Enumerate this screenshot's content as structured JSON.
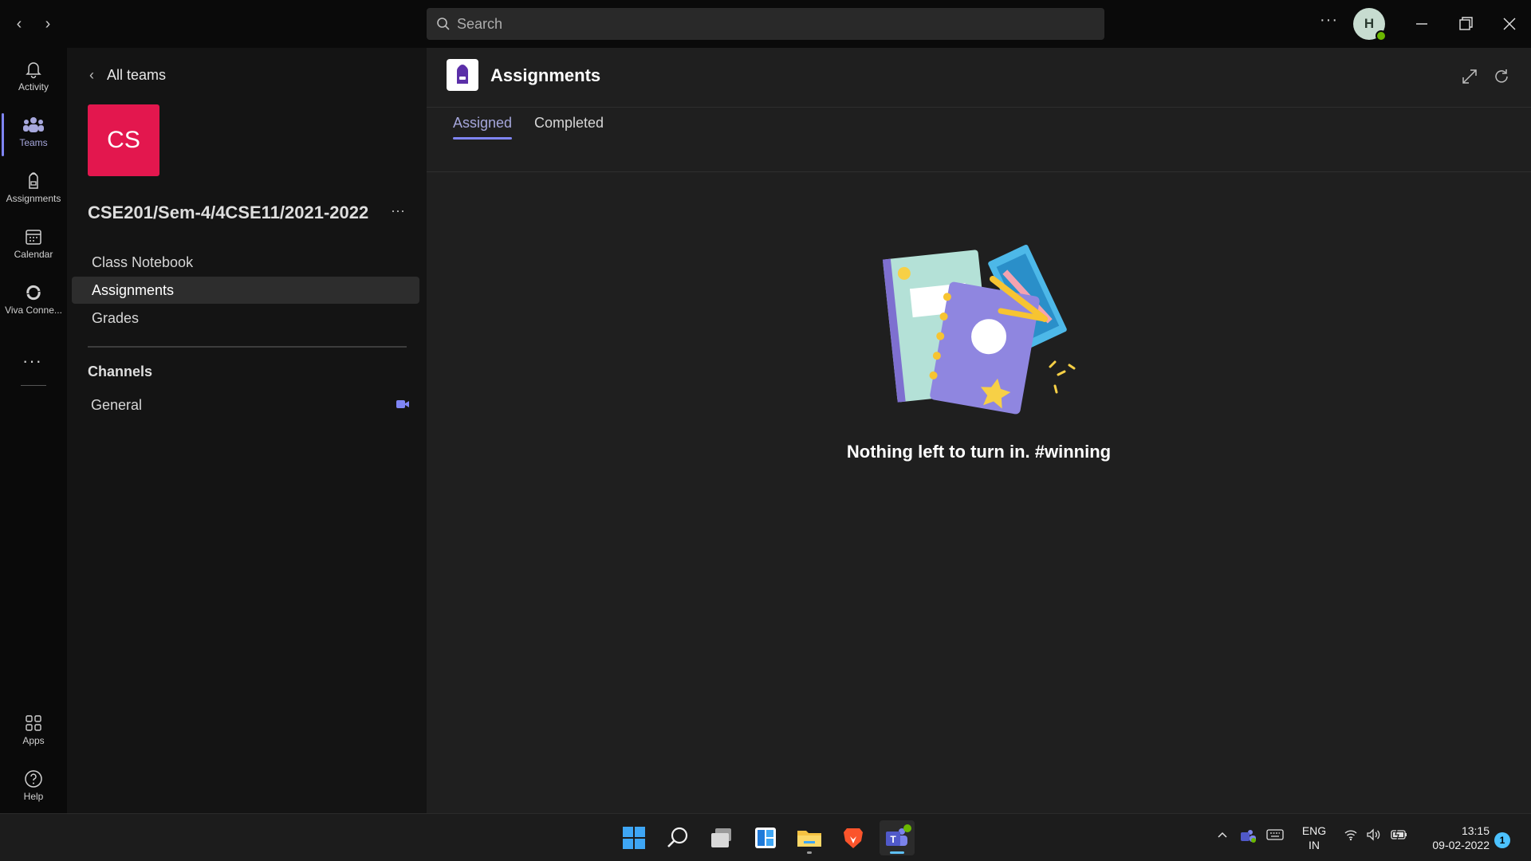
{
  "titlebar": {
    "search_placeholder": "Search",
    "more_label": "···",
    "avatar_initial": "H"
  },
  "rail": {
    "items": [
      {
        "label": "Activity",
        "icon": "bell-icon"
      },
      {
        "label": "Teams",
        "icon": "teams-icon"
      },
      {
        "label": "Assignments",
        "icon": "backpack-icon"
      },
      {
        "label": "Calendar",
        "icon": "calendar-icon"
      },
      {
        "label": "Viva Conne...",
        "icon": "viva-icon"
      }
    ],
    "more": "···",
    "bottom": [
      {
        "label": "Apps",
        "icon": "apps-icon"
      },
      {
        "label": "Help",
        "icon": "help-icon"
      }
    ]
  },
  "team_panel": {
    "back_label": "All teams",
    "tile_initials": "CS",
    "tile_color": "#e3174e",
    "team_name": "CSE201/Sem-4/4CSE11/2021-2022",
    "more_label": "···",
    "links": [
      "Class Notebook",
      "Assignments",
      "Grades"
    ],
    "selected_link": "Assignments",
    "channels_heading": "Channels",
    "channels": [
      "General"
    ]
  },
  "main": {
    "app_title": "Assignments",
    "tabs": [
      "Assigned",
      "Completed"
    ],
    "active_tab": "Assigned",
    "empty_message": "Nothing left to turn in. #winning"
  },
  "taskbar": {
    "lang_line1": "ENG",
    "lang_line2": "IN",
    "time": "13:15",
    "date": "09-02-2022",
    "notification_count": "1"
  },
  "colors": {
    "accent": "#7f85f5",
    "accent_text": "#a6a7dc",
    "team_tile": "#e3174e"
  }
}
